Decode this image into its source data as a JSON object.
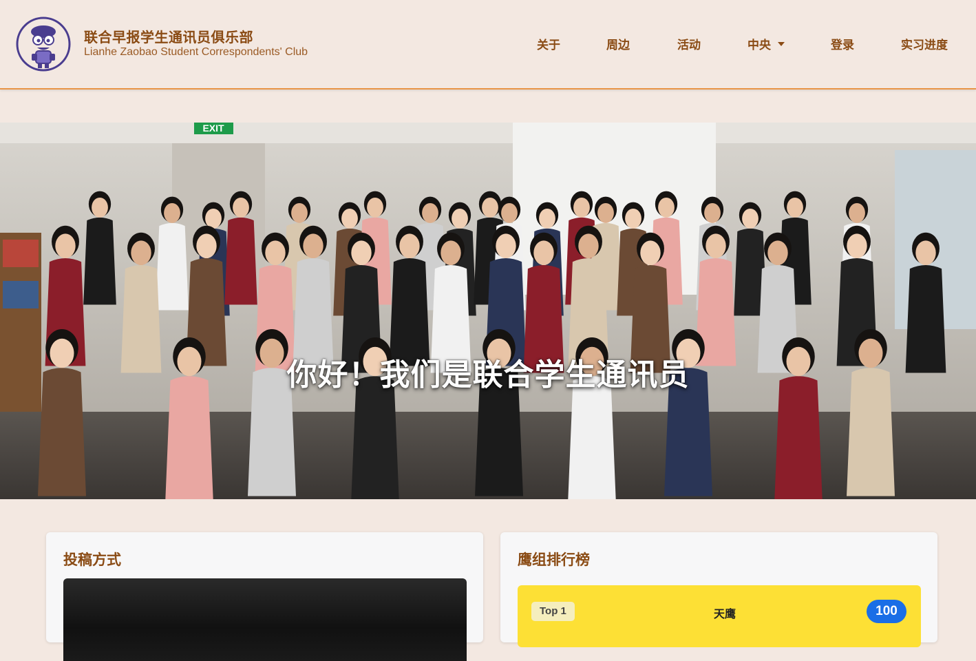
{
  "header": {
    "title": "联合早报学生通讯员俱乐部",
    "subtitle": "Lianhe Zaobao Student Correspondents' Club",
    "logo_icon": "mascot-logo-icon"
  },
  "nav": {
    "about": "关于",
    "surroundings": "周边",
    "events": "活动",
    "central": "中央",
    "login": "登录",
    "progress": "实习进度"
  },
  "hero": {
    "title": "你好！我们是联合学生通讯员",
    "photo_sign": "EXIT"
  },
  "submission_card": {
    "title": "投稿方式"
  },
  "leaderboard_card": {
    "title": "鹰组排行榜",
    "entries": [
      {
        "rank": "Top 1",
        "name": "天鹰",
        "score": "100"
      }
    ]
  },
  "colors": {
    "background": "#f3e8e1",
    "accent": "#e89446",
    "brand": "#8a4b14",
    "rank_highlight": "#fde035",
    "score_badge": "#1a6ee6"
  }
}
